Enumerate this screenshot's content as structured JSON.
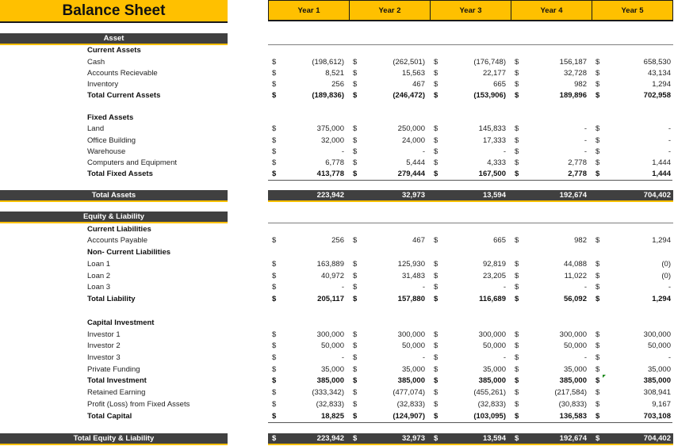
{
  "title": "Balance Sheet",
  "years": [
    "Year 1",
    "Year 2",
    "Year 3",
    "Year 4",
    "Year 5"
  ],
  "currency_symbol": "$",
  "sections": {
    "asset": "Asset",
    "total_assets": "Total Assets",
    "equity_liability": "Equity & Liability",
    "total_equity_liability": "Total Equity & Liability"
  },
  "rows": {
    "current_assets_header": "Current Assets",
    "cash": {
      "label": "Cash",
      "values": [
        "(198,612)",
        "(262,501)",
        "(176,748)",
        "156,187",
        "658,530"
      ]
    },
    "accounts_receivable": {
      "label": "Accounts Recievable",
      "values": [
        "8,521",
        "15,563",
        "22,177",
        "32,728",
        "43,134"
      ]
    },
    "inventory": {
      "label": "Inventory",
      "values": [
        "256",
        "467",
        "665",
        "982",
        "1,294"
      ]
    },
    "total_current_assets": {
      "label": "Total Current Assets",
      "values": [
        "(189,836)",
        "(246,472)",
        "(153,906)",
        "189,896",
        "702,958"
      ]
    },
    "fixed_assets_header": "Fixed Assets",
    "land": {
      "label": "Land",
      "values": [
        "375,000",
        "250,000",
        "145,833",
        "-",
        "-"
      ]
    },
    "office_building": {
      "label": "Office Building",
      "values": [
        "32,000",
        "24,000",
        "17,333",
        "-",
        "-"
      ]
    },
    "warehouse": {
      "label": "Warehouse",
      "values": [
        "-",
        "-",
        "-",
        "-",
        "-"
      ]
    },
    "computers_equipment": {
      "label": "Computers and Equipment",
      "values": [
        "6,778",
        "5,444",
        "4,333",
        "2,778",
        "1,444"
      ]
    },
    "total_fixed_assets": {
      "label": "Total Fixed Assets",
      "values": [
        "413,778",
        "279,444",
        "167,500",
        "2,778",
        "1,444"
      ]
    },
    "total_assets": {
      "values": [
        "223,942",
        "32,973",
        "13,594",
        "192,674",
        "704,402"
      ]
    },
    "current_liabilities_header": "Current Liabilities",
    "accounts_payable": {
      "label": "Accounts Payable",
      "values": [
        "256",
        "467",
        "665",
        "982",
        "1,294"
      ]
    },
    "non_current_liabilities_header": "Non- Current Liabilities",
    "loan1": {
      "label": "Loan 1",
      "values": [
        "163,889",
        "125,930",
        "92,819",
        "44,088",
        "(0)"
      ]
    },
    "loan2": {
      "label": "Loan 2",
      "values": [
        "40,972",
        "31,483",
        "23,205",
        "11,022",
        "(0)"
      ]
    },
    "loan3": {
      "label": "Loan 3",
      "values": [
        "-",
        "-",
        "-",
        "-",
        "-"
      ]
    },
    "total_liability": {
      "label": "Total Liability",
      "values": [
        "205,117",
        "157,880",
        "116,689",
        "56,092",
        "1,294"
      ]
    },
    "capital_investment_header": "Capital Investment",
    "investor1": {
      "label": "Investor 1",
      "values": [
        "300,000",
        "300,000",
        "300,000",
        "300,000",
        "300,000"
      ]
    },
    "investor2": {
      "label": "Investor 2",
      "values": [
        "50,000",
        "50,000",
        "50,000",
        "50,000",
        "50,000"
      ]
    },
    "investor3": {
      "label": "Investor 3",
      "values": [
        "-",
        "-",
        "-",
        "-",
        "-"
      ]
    },
    "private_funding": {
      "label": "Private Funding",
      "values": [
        "35,000",
        "35,000",
        "35,000",
        "35,000",
        "35,000"
      ]
    },
    "total_investment": {
      "label": "Total Investment",
      "values": [
        "385,000",
        "385,000",
        "385,000",
        "385,000",
        "385,000"
      ]
    },
    "retained_earning": {
      "label": "Retained Earning",
      "values": [
        "(333,342)",
        "(477,074)",
        "(455,261)",
        "(217,584)",
        "308,941"
      ]
    },
    "profit_loss_fixed": {
      "label": "Profit (Loss) from Fixed Assets",
      "values": [
        "(32,833)",
        "(32,833)",
        "(32,833)",
        "(30,833)",
        "9,167"
      ]
    },
    "total_capital": {
      "label": "Total Capital",
      "values": [
        "18,825",
        "(124,907)",
        "(103,095)",
        "136,583",
        "703,108"
      ]
    },
    "total_equity_liability": {
      "values": [
        "223,942",
        "32,973",
        "13,594",
        "192,674",
        "704,402"
      ]
    }
  },
  "colors": {
    "accent": "#FFC000",
    "bar": "#404040"
  }
}
